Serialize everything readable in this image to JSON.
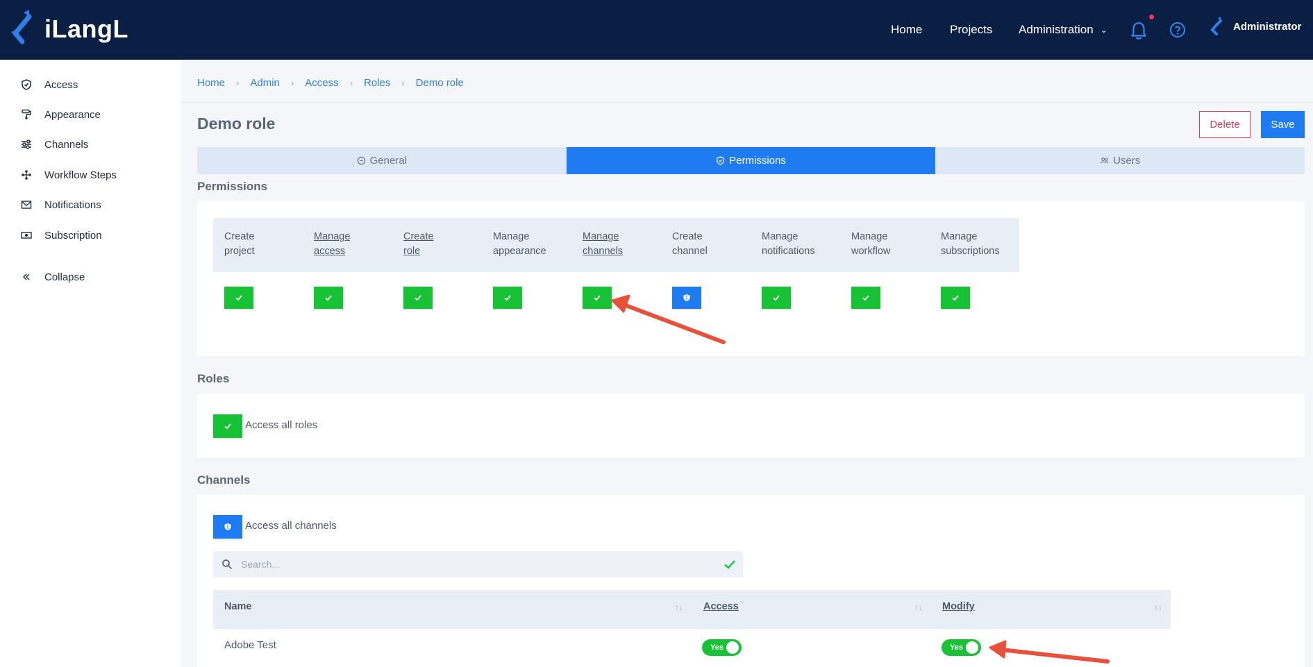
{
  "brand": {
    "name": "iLangL"
  },
  "nav": {
    "home": "Home",
    "projects": "Projects",
    "administration": "Administration",
    "user": "Administrator"
  },
  "sidebar": {
    "items": [
      {
        "label": "Access",
        "icon": "shield-icon"
      },
      {
        "label": "Appearance",
        "icon": "paint-roller-icon"
      },
      {
        "label": "Channels",
        "icon": "sliders-icon"
      },
      {
        "label": "Workflow Steps",
        "icon": "workflow-icon"
      },
      {
        "label": "Notifications",
        "icon": "envelope-icon"
      },
      {
        "label": "Subscription",
        "icon": "money-icon"
      },
      {
        "label": "Collapse",
        "icon": "double-chevron-left-icon"
      }
    ]
  },
  "breadcrumb": [
    "Home",
    "Admin",
    "Access",
    "Roles",
    "Demo role"
  ],
  "page": {
    "title": "Demo role",
    "delete_label": "Delete",
    "save_label": "Save"
  },
  "tabs": [
    {
      "label": "General",
      "active": false
    },
    {
      "label": "Permissions",
      "active": true
    },
    {
      "label": "Users",
      "active": false
    }
  ],
  "permissions": {
    "title": "Permissions",
    "columns": [
      {
        "line1": "Create",
        "line2": "project",
        "link": false,
        "state": "checked"
      },
      {
        "line1": "Manage",
        "line2": "access",
        "link": true,
        "state": "checked"
      },
      {
        "line1": "Create",
        "line2": "role",
        "link": true,
        "state": "checked"
      },
      {
        "line1": "Manage",
        "line2": "appearance",
        "link": false,
        "state": "checked"
      },
      {
        "line1": "Manage",
        "line2": "channels",
        "link": true,
        "state": "checked"
      },
      {
        "line1": "Create",
        "line2": "channel",
        "link": false,
        "state": "shield"
      },
      {
        "line1": "Manage",
        "line2": "notifications",
        "link": false,
        "state": "checked"
      },
      {
        "line1": "Manage",
        "line2": "workflow",
        "link": false,
        "state": "checked"
      },
      {
        "line1": "Manage",
        "line2": "subscriptions",
        "link": false,
        "state": "checked"
      }
    ]
  },
  "roles": {
    "title": "Roles",
    "access_all_label": "Access all roles"
  },
  "channels": {
    "title": "Channels",
    "access_all_label": "Access all channels",
    "search_placeholder": "Search...",
    "columns": {
      "name": "Name",
      "access": "Access",
      "modify": "Modify"
    },
    "rows": [
      {
        "name": "Adobe Test",
        "access": "Yes",
        "modify": "Yes"
      }
    ]
  },
  "colors": {
    "topbar": "#0b1f45",
    "primary": "#1e7bf2",
    "success": "#18c235",
    "danger": "#e23a5a",
    "annotation": "#e8503a"
  }
}
